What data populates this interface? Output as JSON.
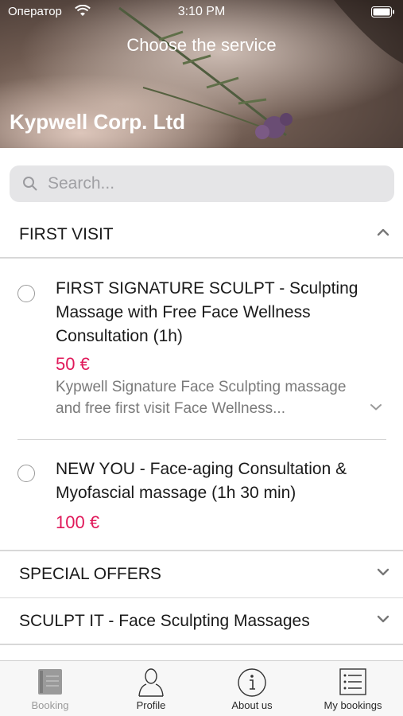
{
  "status_bar": {
    "carrier": "Оператор",
    "time": "3:10 PM"
  },
  "header": {
    "title": "Choose the service",
    "company": "Kypwell Corp. Ltd"
  },
  "search": {
    "placeholder": "Search..."
  },
  "sections": [
    {
      "label": "FIRST VISIT",
      "expanded": true,
      "services": [
        {
          "title": "FIRST SIGNATURE SCULPT - Sculpting Massage with Free Face Wellness Consultation (1h)",
          "price": "50 €",
          "description": "Kypwell Signature Face Sculpting massage and free first visit Face Wellness..."
        },
        {
          "title": "NEW YOU - Face-aging Consultation & Myofascial massage (1h 30 min)",
          "price": "100 €"
        }
      ]
    },
    {
      "label": "SPECIAL OFFERS",
      "expanded": false
    },
    {
      "label": "SCULPT IT - Face Sculpting Massages",
      "expanded": false
    }
  ],
  "tabs": [
    {
      "label": "Booking",
      "icon": "booking-icon",
      "active": true
    },
    {
      "label": "Profile",
      "icon": "profile-icon",
      "active": false
    },
    {
      "label": "About us",
      "icon": "info-icon",
      "active": false
    },
    {
      "label": "My bookings",
      "icon": "list-icon",
      "active": false
    }
  ],
  "colors": {
    "price": "#e0195a",
    "search_bg": "#e5e5e7",
    "tab_bar_bg": "#f7f7f7"
  }
}
